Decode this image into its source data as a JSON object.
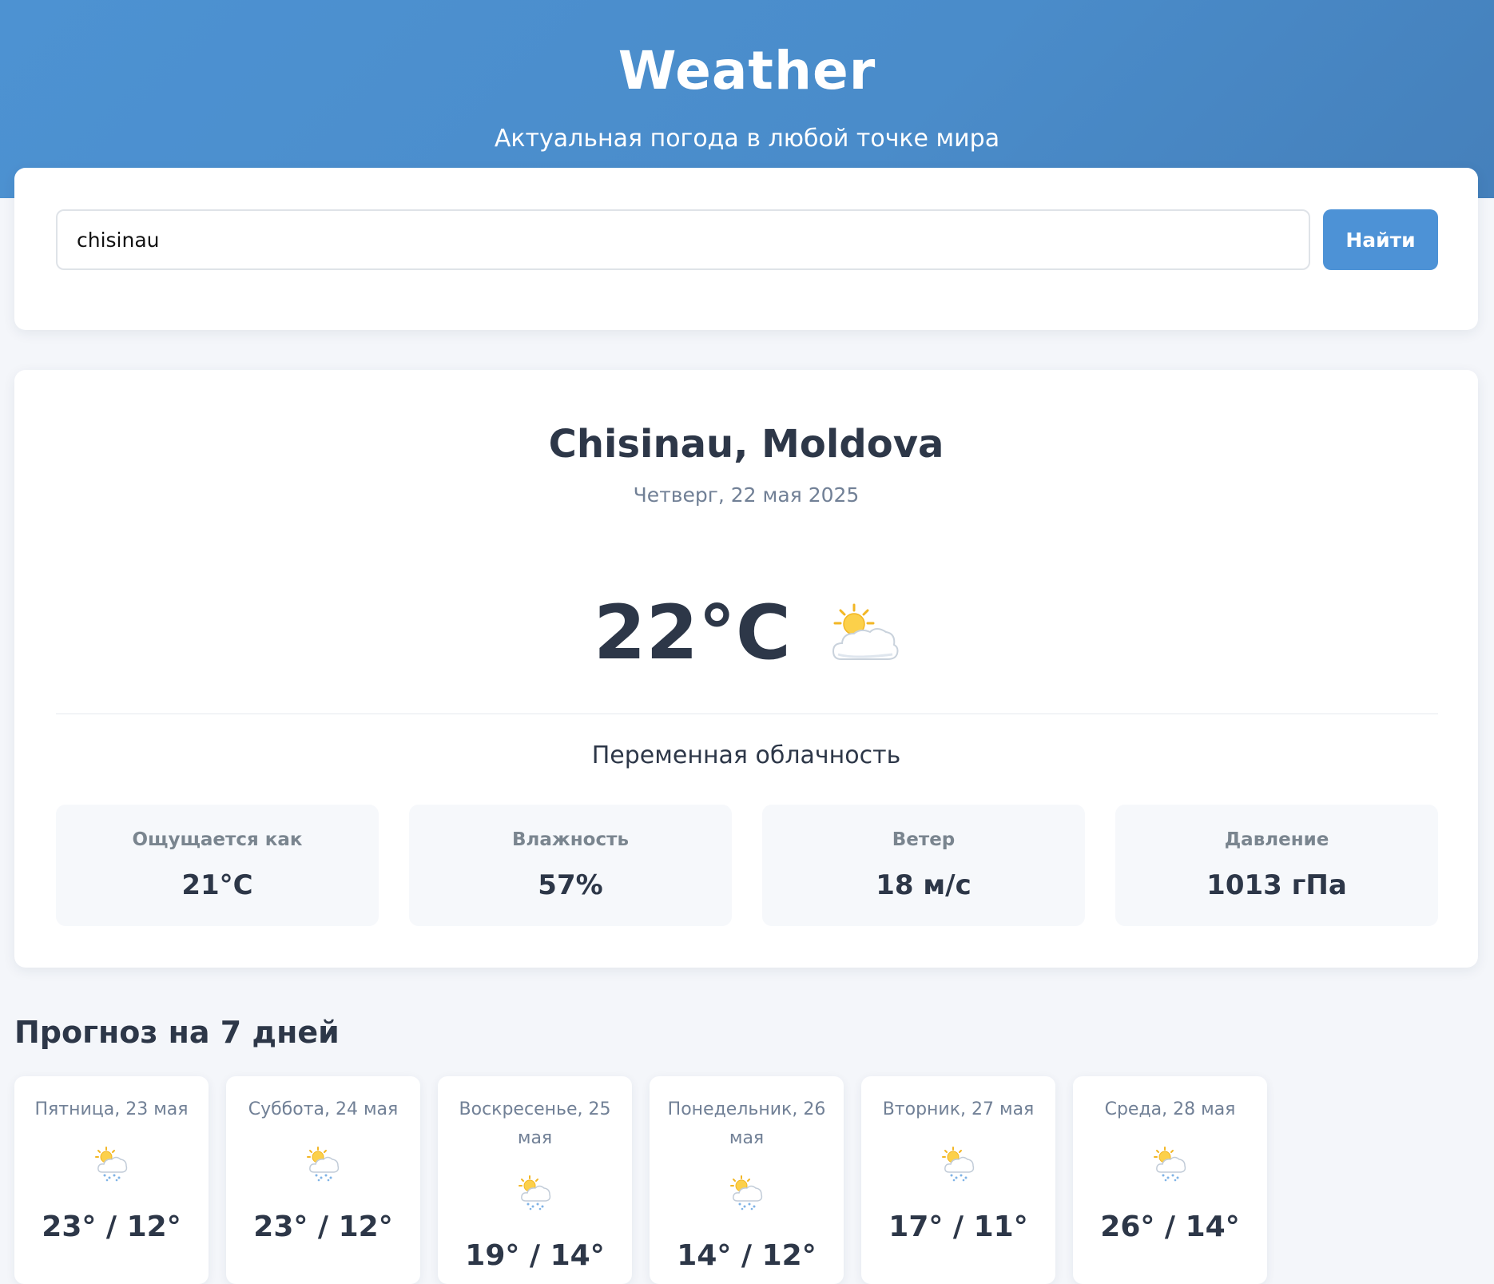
{
  "header": {
    "title": "Weather",
    "subtitle": "Актуальная погода в любой точке мира"
  },
  "search": {
    "value": "chisinau",
    "button_label": "Найти"
  },
  "current": {
    "city": "Chisinau, Moldova",
    "date": "Четверг, 22 мая 2025",
    "temperature": "22°C",
    "icon": "partly-cloudy-icon",
    "condition": "Переменная облачность",
    "stats": [
      {
        "label": "Ощущается как",
        "value": "21°C"
      },
      {
        "label": "Влажность",
        "value": "57%"
      },
      {
        "label": "Ветер",
        "value": "18 м/с"
      },
      {
        "label": "Давление",
        "value": "1013 гПа"
      }
    ]
  },
  "forecast": {
    "title": "Прогноз на 7 дней",
    "days": [
      {
        "date": "Пятница, 23 мая",
        "icon": "sun-cloud-rain-icon",
        "temp": "23° / 12°"
      },
      {
        "date": "Суббота, 24 мая",
        "icon": "sun-cloud-rain-icon",
        "temp": "23° / 12°"
      },
      {
        "date": "Воскресенье, 25 мая",
        "icon": "sun-cloud-rain-icon",
        "temp": "19° / 14°"
      },
      {
        "date": "Понедельник, 26 мая",
        "icon": "sun-cloud-rain-icon",
        "temp": "14° / 12°"
      },
      {
        "date": "Вторник, 27 мая",
        "icon": "sun-cloud-rain-icon",
        "temp": "17° / 11°"
      },
      {
        "date": "Среда, 28 мая",
        "icon": "sun-cloud-rain-icon",
        "temp": "26° / 14°"
      }
    ]
  },
  "colors": {
    "header_gradient_start": "#4d92d2",
    "header_gradient_end": "#4580bb",
    "button": "#4d92d6",
    "page_background": "#f4f6fa",
    "text_primary": "#2d3748",
    "text_secondary": "#718096"
  }
}
